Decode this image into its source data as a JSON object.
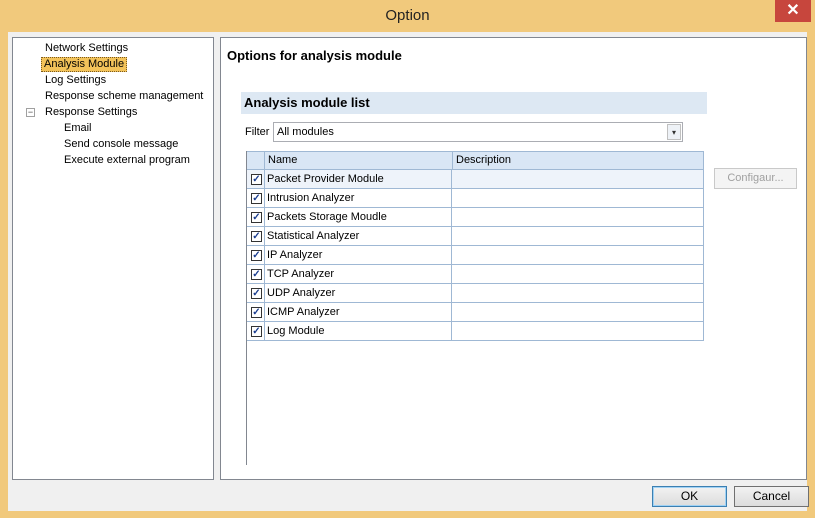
{
  "window": {
    "title": "Option",
    "close_glyph": "✕"
  },
  "tree": {
    "items": [
      {
        "label": "Network Settings",
        "selected": false
      },
      {
        "label": "Analysis Module",
        "selected": true
      },
      {
        "label": "Log Settings",
        "selected": false
      },
      {
        "label": "Response scheme management",
        "selected": false
      },
      {
        "label": "Response Settings",
        "selected": false,
        "expanded": true,
        "expander_glyph": "−"
      },
      {
        "label": "Email",
        "selected": false
      },
      {
        "label": "Send console message",
        "selected": false
      },
      {
        "label": "Execute external program",
        "selected": false
      }
    ]
  },
  "panel": {
    "title": "Options for analysis module",
    "section_title": "Analysis module list",
    "filter_label": "Filter",
    "filter_value": "All modules",
    "dropdown_glyph": "▾",
    "columns": [
      "Name",
      "Description"
    ],
    "check_glyph": "✓",
    "rows": [
      {
        "name": "Packet Provider Module",
        "description": "",
        "checked": true
      },
      {
        "name": "Intrusion Analyzer",
        "description": "",
        "checked": true
      },
      {
        "name": "Packets Storage Moudle",
        "description": "",
        "checked": true
      },
      {
        "name": "Statistical Analyzer",
        "description": "",
        "checked": true
      },
      {
        "name": "IP Analyzer",
        "description": "",
        "checked": true
      },
      {
        "name": "TCP Analyzer",
        "description": "",
        "checked": true
      },
      {
        "name": "UDP Analyzer",
        "description": "",
        "checked": true
      },
      {
        "name": "ICMP Analyzer",
        "description": "",
        "checked": true
      },
      {
        "name": "Log Module",
        "description": "",
        "checked": true
      }
    ],
    "configure_label": "Configaur..."
  },
  "buttons": {
    "ok": "OK",
    "cancel": "Cancel"
  }
}
